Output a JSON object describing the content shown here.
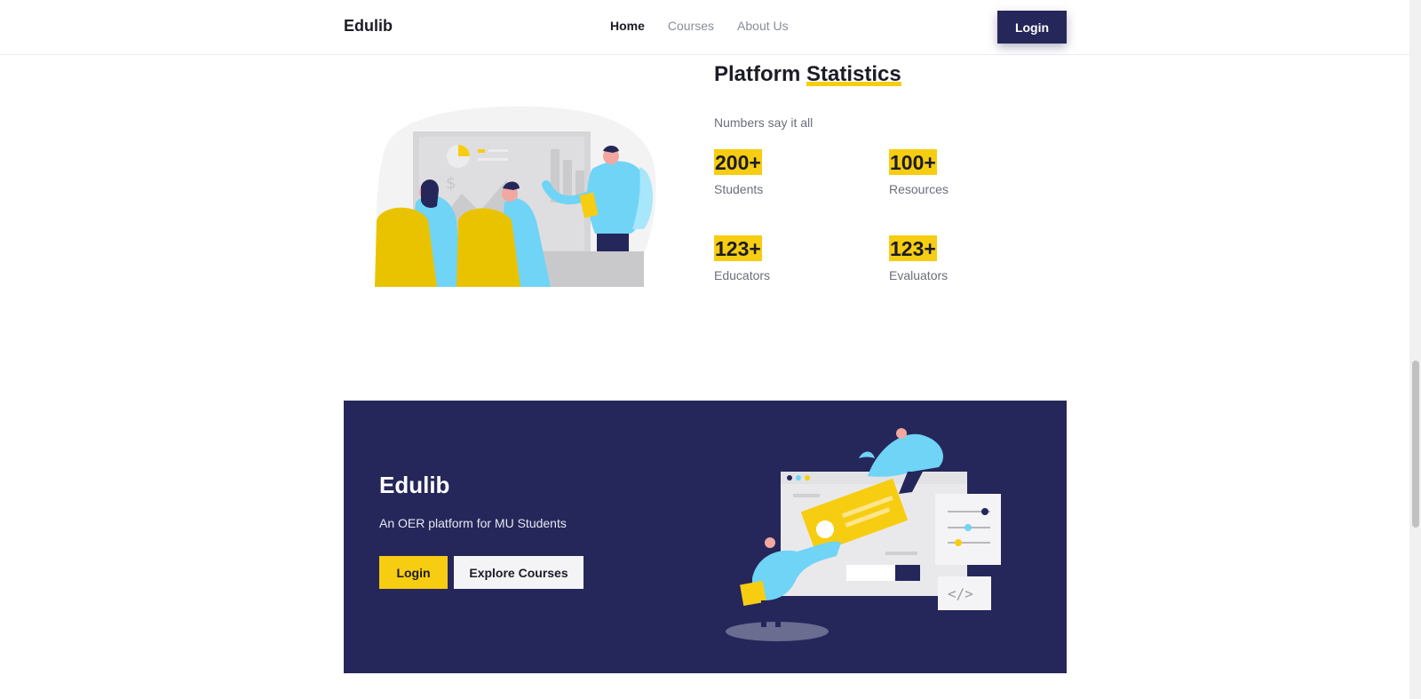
{
  "header": {
    "brand": "Edulib",
    "nav": [
      {
        "label": "Home",
        "active": true
      },
      {
        "label": "Courses",
        "active": false
      },
      {
        "label": "About Us",
        "active": false
      }
    ],
    "login_label": "Login"
  },
  "stats": {
    "title_prefix": "Platform",
    "title_highlight": "Statistics",
    "subtitle": "Numbers say it all",
    "items": [
      {
        "value": "200+",
        "label": "Students"
      },
      {
        "value": "100+",
        "label": "Resources"
      },
      {
        "value": "123+",
        "label": "Educators"
      },
      {
        "value": "123+",
        "label": "Evaluators"
      }
    ]
  },
  "cta": {
    "title": "Edulib",
    "subtitle": "An OER platform for MU Students",
    "login_label": "Login",
    "explore_label": "Explore Courses"
  },
  "colors": {
    "navy": "#25275a",
    "accent_yellow": "#f7cd12",
    "text_dark": "#1c1c28",
    "text_muted": "#6b6e7c"
  }
}
